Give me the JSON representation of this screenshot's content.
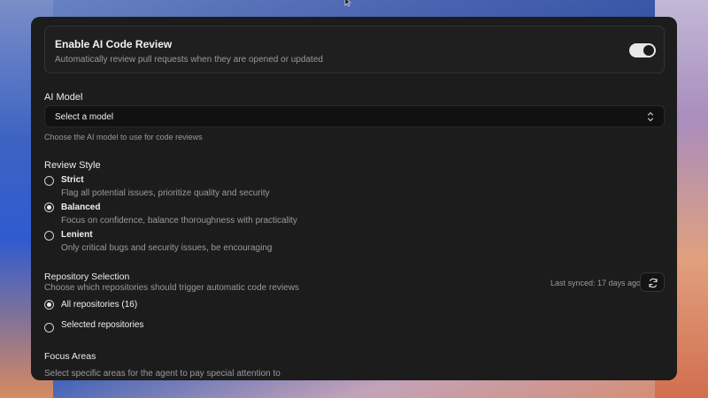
{
  "enable": {
    "title": "Enable AI Code Review",
    "description": "Automatically review pull requests when they are opened or updated",
    "enabled": true
  },
  "ai_model": {
    "label": "AI Model",
    "selected": "Select a model",
    "help": "Choose the AI model to use for code reviews"
  },
  "review_style": {
    "label": "Review Style",
    "options": [
      {
        "title": "Strict",
        "description": "Flag all potential issues, prioritize quality and security",
        "checked": false
      },
      {
        "title": "Balanced",
        "description": "Focus on confidence, balance thoroughness with practicality",
        "checked": true
      },
      {
        "title": "Lenient",
        "description": "Only critical bugs and security issues, be encouraging",
        "checked": false
      }
    ]
  },
  "repository_selection": {
    "label": "Repository Selection",
    "description": "Choose which repositories should trigger automatic code reviews",
    "last_synced": "Last synced: 17 days ago",
    "options": [
      {
        "title": "All repositories (16)",
        "checked": true
      },
      {
        "title": "Selected repositories",
        "checked": false
      }
    ]
  },
  "focus_areas": {
    "label": "Focus Areas",
    "description": "Select specific areas for the agent to pay special attention to"
  },
  "colors": {
    "panel_bg": "#1c1c1d",
    "text_primary": "#f0f0f0",
    "text_muted": "#9a9a9e"
  }
}
